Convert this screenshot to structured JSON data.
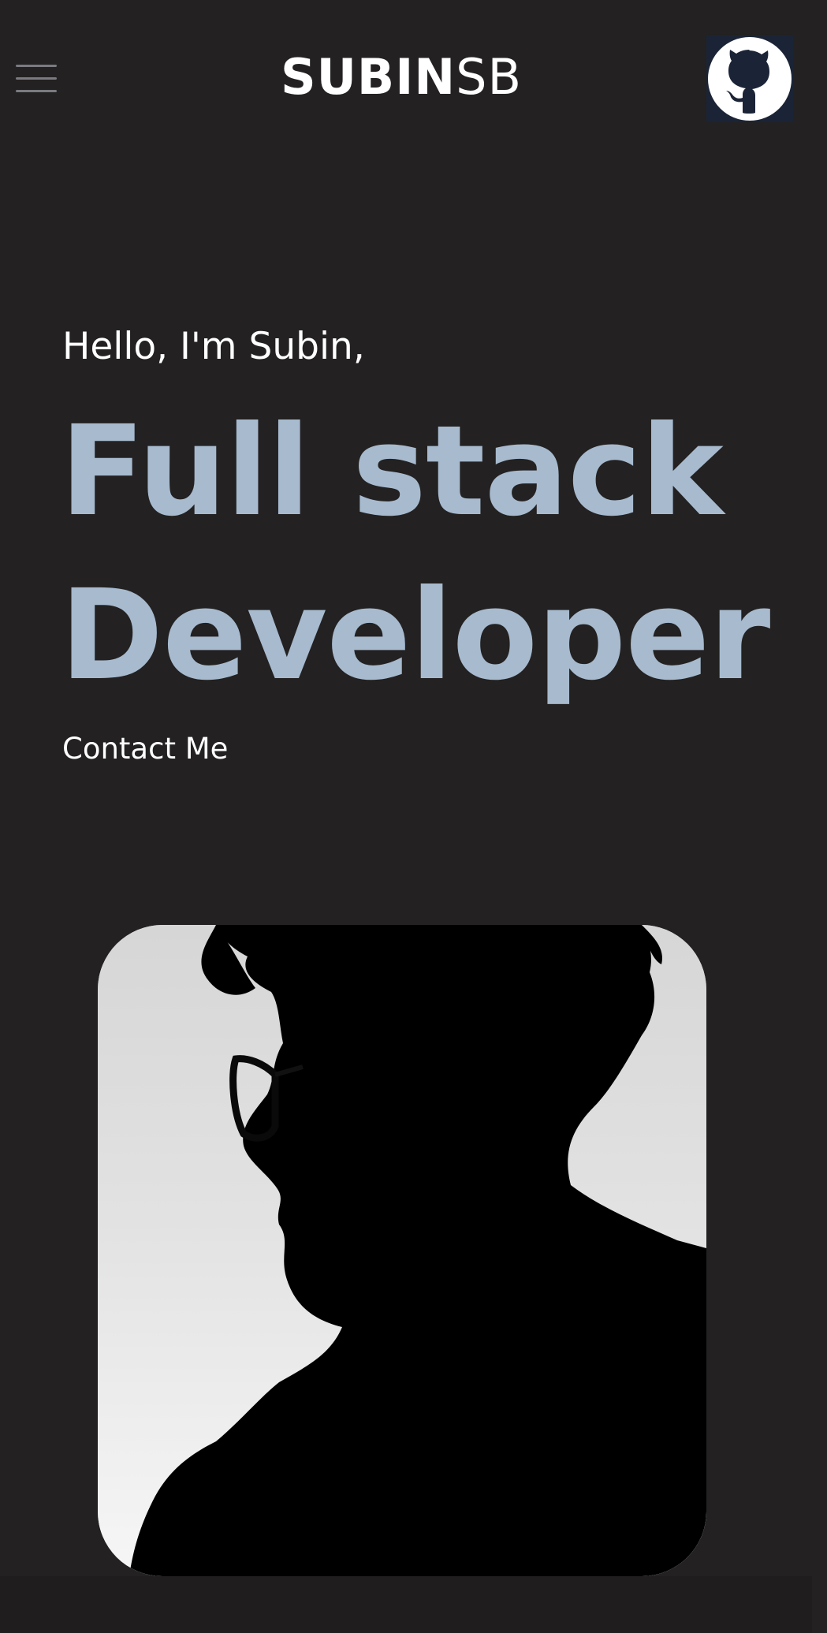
{
  "header": {
    "logo_bold": "SUBIN",
    "logo_light": "SB",
    "menu_icon": "hamburger-menu-icon",
    "github_icon": "github-octocat-icon"
  },
  "hero": {
    "greeting": "Hello, I'm Subin,",
    "headline_line1": "Full stack",
    "headline_line2": "Developer",
    "contact_label": "Contact Me"
  },
  "photo": {
    "subject": "portrait-silhouette"
  },
  "colors": {
    "background": "#232121",
    "accent": "#a7bace",
    "text": "#ffffff",
    "github_bg": "#1b2436"
  }
}
